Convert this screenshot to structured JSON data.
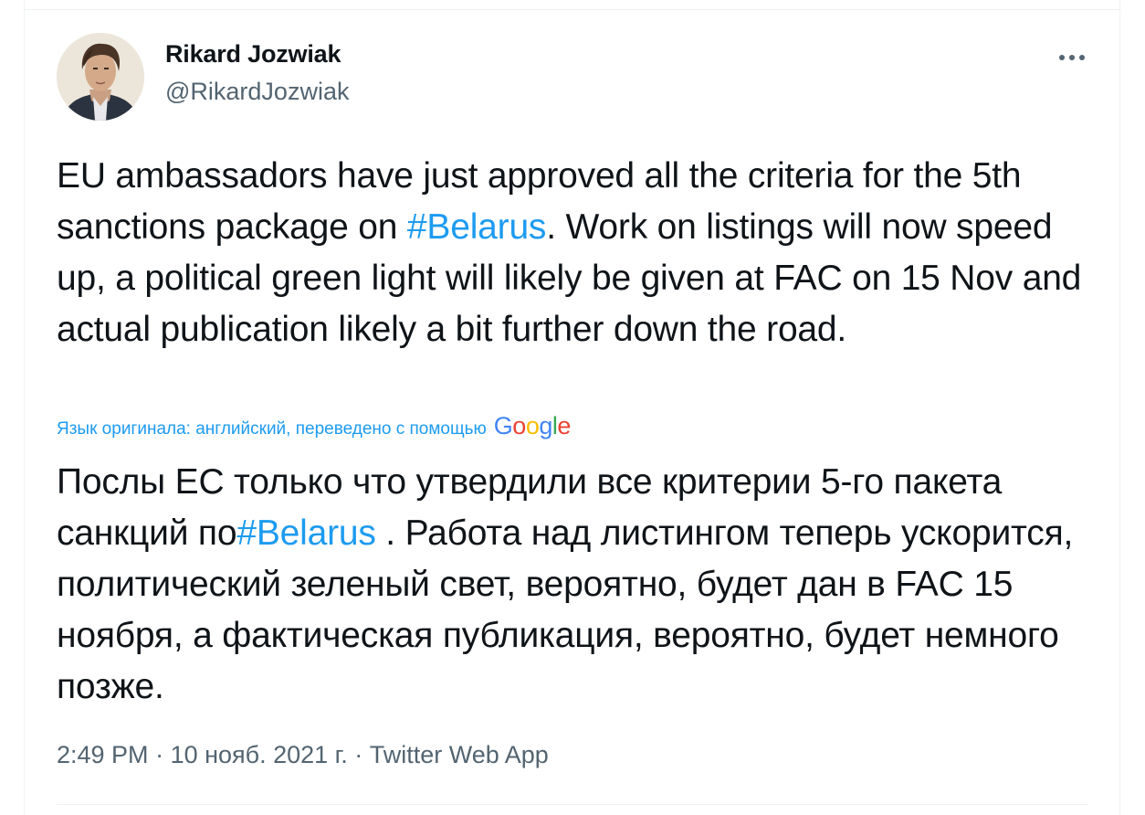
{
  "author": {
    "name": "Rikard Jozwiak",
    "handle": "@RikardJozwiak"
  },
  "tweet": {
    "original": {
      "before": "EU ambassadors have just approved all the criteria for the 5th sanctions package on ",
      "hashtag": "#Belarus",
      "after": ". Work on listings will now speed up, a political green light will likely be given at FAC on 15 Nov and actual publication likely a bit further down the road."
    },
    "translation_note": "Язык оригинала: английский, переведено с помощью",
    "translation_provider": {
      "g1": "G",
      "o1": "o",
      "o2": "o",
      "g2": "g",
      "l": "l",
      "e": "e"
    },
    "translated": {
      "before": "Послы ЕС только что утвердили все критерии 5-го пакета санкций по",
      "hashtag": "#Belarus",
      "after": " . Работа над листингом теперь ускорится, политический зеленый свет, вероятно, будет дан в FAC 15 ноября, а фактическая публикация, вероятно, будет немного позже."
    }
  },
  "meta": {
    "time": "2:49 PM",
    "separator1": " · ",
    "date": "10 нояб. 2021 г.",
    "separator2": " · ",
    "source": "Twitter Web App"
  },
  "icons": {
    "more": "more-dots-icon",
    "avatar": "avatar"
  },
  "colors": {
    "link": "#1d9bf0",
    "secondary_text": "#536471",
    "primary_text": "#0f1419"
  }
}
